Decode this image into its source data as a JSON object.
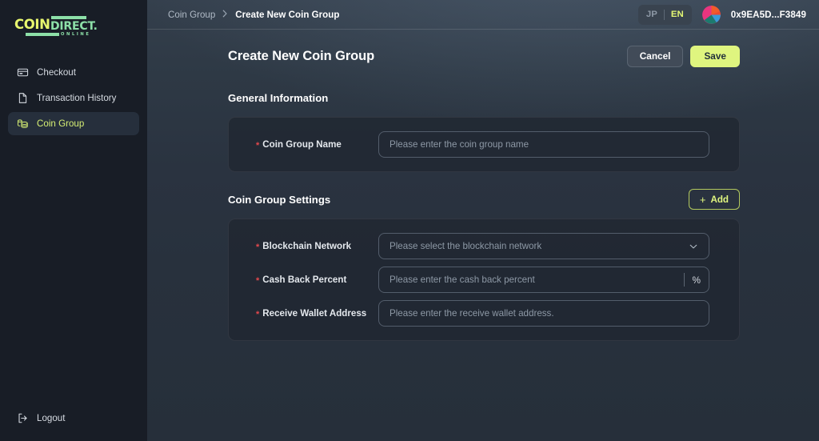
{
  "brand": {
    "logo_coin": "COIN",
    "logo_direct": "DIRECT.",
    "logo_online": "ONLINE",
    "accent": "#dff57f",
    "accent_mint": "#8de0a8",
    "accent_yellow": "#e8f76e"
  },
  "sidebar": {
    "items": [
      {
        "label": "Checkout",
        "icon": "card-icon",
        "active": false
      },
      {
        "label": "Transaction History",
        "icon": "document-icon",
        "active": false
      },
      {
        "label": "Coin Group",
        "icon": "coins-icon",
        "active": true
      }
    ],
    "logout": {
      "label": "Logout",
      "icon": "logout-icon"
    }
  },
  "topbar": {
    "breadcrumb": {
      "parent": "Coin Group",
      "separator": ">",
      "current": "Create New Coin Group"
    },
    "language": {
      "options": [
        "JP",
        "EN"
      ],
      "jp": "JP",
      "en": "EN",
      "selected": "EN"
    },
    "wallet": "0x9EA5D...F3849"
  },
  "page": {
    "title": "Create New Coin Group",
    "cancel_label": "Cancel",
    "save_label": "Save"
  },
  "general_information": {
    "title": "General Information",
    "fields": [
      {
        "label": "Coin Group Name",
        "required": true,
        "placeholder": "Please enter the coin group name",
        "value": "",
        "type": "text"
      }
    ]
  },
  "coin_group_settings": {
    "title": "Coin Group Settings",
    "add_label": "Add",
    "add_icon": "plus-icon",
    "fields": [
      {
        "label": "Blockchain Network",
        "required": true,
        "placeholder": "Please select the blockchain network",
        "value": "",
        "type": "select"
      },
      {
        "label": "Cash Back Percent",
        "required": true,
        "placeholder": "Please enter the cash back percent",
        "value": "",
        "type": "text",
        "suffix": "%"
      },
      {
        "label": "Receive Wallet Address",
        "required": true,
        "placeholder": "Please enter the receive wallet address.",
        "value": "",
        "type": "text"
      }
    ]
  }
}
